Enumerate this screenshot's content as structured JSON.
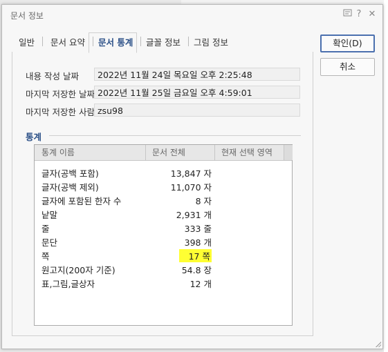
{
  "dialog": {
    "title": "문서 정보",
    "help_icon": "help-panel-icon",
    "question_icon": "?",
    "close_icon": "✕"
  },
  "tabs": [
    {
      "label": "일반",
      "active": false
    },
    {
      "label": "문서 요약",
      "active": false
    },
    {
      "label": "문서 통계",
      "active": true
    },
    {
      "label": "글꼴 정보",
      "active": false
    },
    {
      "label": "그림 정보",
      "active": false
    }
  ],
  "fields": [
    {
      "label": "내용 작성 날짜",
      "value": "2022년 11월 24일 목요일 오후 2:25:48"
    },
    {
      "label": "마지막 저장한 날짜",
      "value": "2022년 11월 25일 금요일 오후 4:59:01"
    },
    {
      "label": "마지막 저장한 사람",
      "value": "zsu98"
    }
  ],
  "stats": {
    "section_title": "통계",
    "columns": [
      "통계 이름",
      "문서 전체",
      "현재 선택 영역"
    ],
    "rows": [
      {
        "name": "글자(공백 포함)",
        "total": "13,847 자",
        "highlighted": false
      },
      {
        "name": "글자(공백 제외)",
        "total": "11,070 자",
        "highlighted": false
      },
      {
        "name": "글자에 포함된 한자 수",
        "total": "8 자",
        "highlighted": false
      },
      {
        "name": "낱말",
        "total": "2,931 개",
        "highlighted": false
      },
      {
        "name": "줄",
        "total": "333 줄",
        "highlighted": false
      },
      {
        "name": "문단",
        "total": "398 개",
        "highlighted": false
      },
      {
        "name": "쪽",
        "total": "17 쪽",
        "highlighted": true
      },
      {
        "name": "원고지(200자 기준)",
        "total": "54.8 장",
        "highlighted": false
      },
      {
        "name": "표,그림,글상자",
        "total": "12 개",
        "highlighted": false
      }
    ]
  },
  "buttons": {
    "ok": "확인(D)",
    "cancel": "취소"
  },
  "colors": {
    "accent": "#2a4f87",
    "highlight": "#ffff33"
  }
}
